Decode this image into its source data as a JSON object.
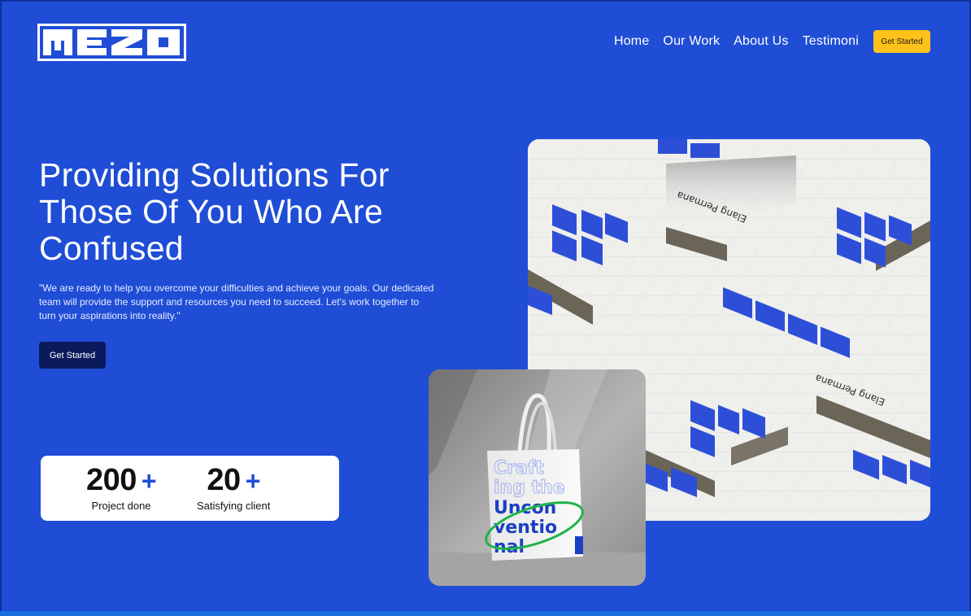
{
  "brand": {
    "logo_text": "MEZO",
    "logo_alt": "mezo-logo"
  },
  "nav": {
    "items": [
      {
        "label": "Home"
      },
      {
        "label": "Our Work"
      },
      {
        "label": "About Us"
      },
      {
        "label": "Testimoni"
      }
    ],
    "cta_label": "Get Started"
  },
  "hero": {
    "title": "Providing Solutions For Those Of You Who Are Confused",
    "description": "\"We are ready to help you overcome your difficulties and achieve your goals. Our dedicated team will provide the support and resources you need to succeed. Let's work together to turn your aspirations into reality.\"",
    "cta_label": "Get Started"
  },
  "stats": [
    {
      "value": "200",
      "suffix": "+",
      "label": "Project done"
    },
    {
      "value": "20",
      "suffix": "+",
      "label": "Satisfying client"
    }
  ],
  "mockup": {
    "card_text": "Elang Permana"
  },
  "tote": {
    "bag_text": [
      "Craft",
      "ing the",
      "Uncon",
      "ventio",
      "nal"
    ]
  },
  "colors": {
    "background": "#1f4dd6",
    "accent_yellow": "#ffc21a",
    "dark_button": "#0b1a5c",
    "white": "#ffffff"
  }
}
